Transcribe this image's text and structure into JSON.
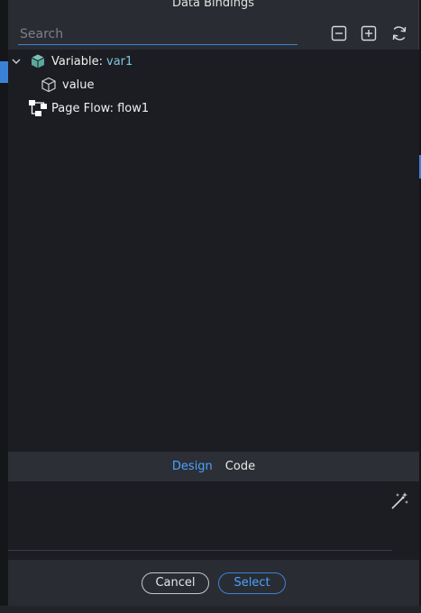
{
  "dialog": {
    "title": "Data Bindings"
  },
  "toolbar": {
    "search_placeholder": "Search",
    "collapse_icon": "minus-square-icon",
    "expand_icon": "plus-square-icon",
    "refresh_icon": "refresh-icon"
  },
  "tree": {
    "items": [
      {
        "label": "Variable:",
        "value": "var1",
        "icon": "cube-filled-icon",
        "expanded": true
      },
      {
        "label": "value",
        "icon": "cube-outline-icon"
      },
      {
        "label": "Page Flow: flow1",
        "icon": "flow-icon"
      }
    ]
  },
  "tabs": [
    {
      "label": "Design",
      "active": true
    },
    {
      "label": "Code",
      "active": false
    }
  ],
  "editor": {
    "wand_icon": "magic-wand-icon"
  },
  "footer": {
    "cancel_label": "Cancel",
    "select_label": "Select"
  },
  "colors": {
    "accent": "#3b82d6",
    "accent_text": "#4aa3ff",
    "variable_value": "#7fc6dd",
    "cube_icon": "#5aa89a"
  }
}
